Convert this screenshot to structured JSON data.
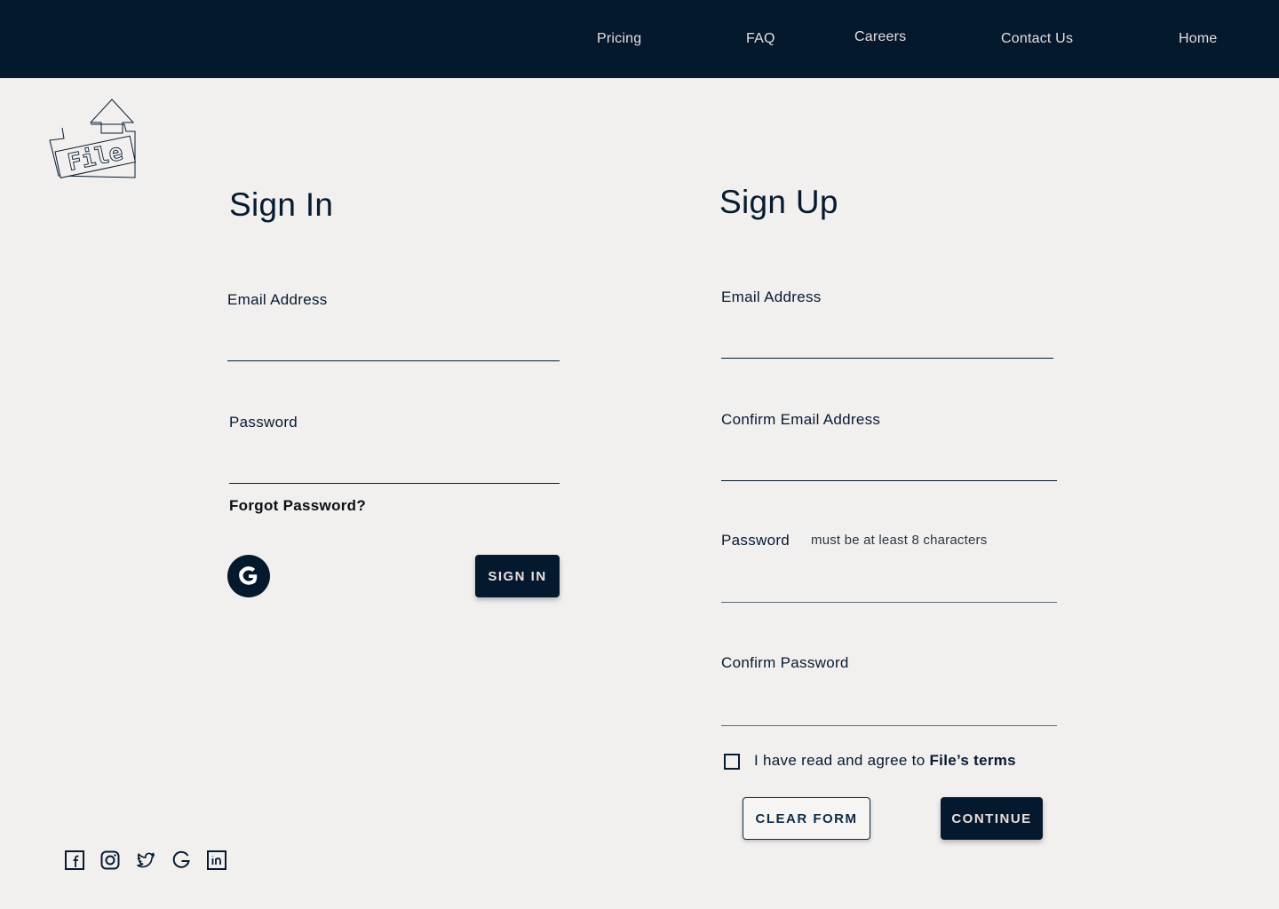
{
  "nav": {
    "pricing": "Pricing",
    "faq": "FAQ",
    "careers": "Careers",
    "contact": "Contact Us",
    "home": "Home"
  },
  "logo": {
    "text": "File"
  },
  "signin": {
    "title": "Sign In",
    "email_label": "Email Address",
    "email_value": "",
    "password_label": "Password",
    "password_value": "",
    "forgot": "Forgot Password?",
    "google_icon": "google-icon",
    "button": "SIGN IN"
  },
  "signup": {
    "title": "Sign Up",
    "email_label": "Email Address",
    "confirm_email_label": "Confirm Email Address",
    "password_label": "Password",
    "password_hint": "must be at least 8 characters",
    "confirm_password_label": "Confirm Password",
    "terms_text": "I have read and agree to ",
    "terms_link": "File’s terms",
    "terms_checked": false,
    "clear_button": "CLEAR FORM",
    "continue_button": "CONTINUE"
  },
  "social": [
    "facebook-icon",
    "instagram-icon",
    "twitter-icon",
    "google-icon",
    "linkedin-icon"
  ],
  "colors": {
    "navy": "#04182e",
    "background": "#f2f0ef",
    "nav_text": "#e7dede"
  }
}
